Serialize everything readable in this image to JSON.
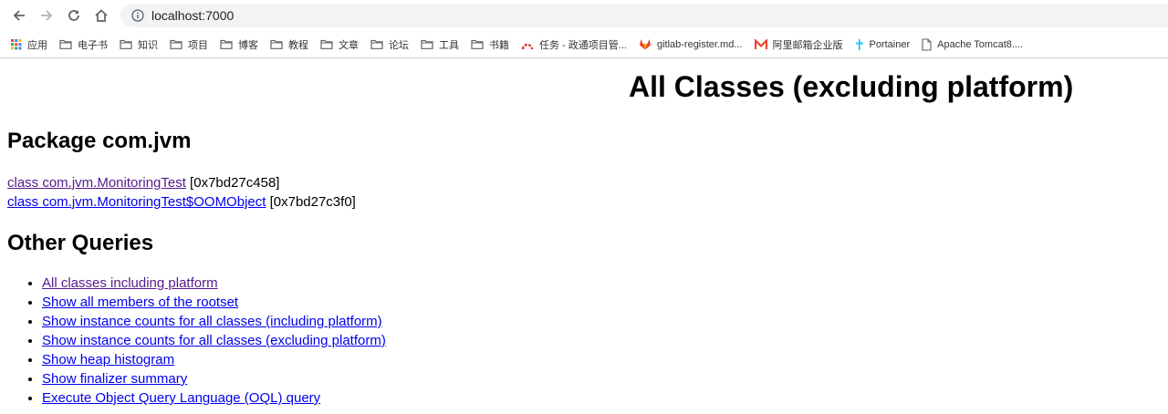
{
  "browser": {
    "url": "localhost:7000",
    "bookmarks": [
      {
        "label": "应用",
        "icon": "apps-grid-icon"
      },
      {
        "label": "电子书",
        "icon": "folder-icon"
      },
      {
        "label": "知识",
        "icon": "folder-icon"
      },
      {
        "label": "项目",
        "icon": "folder-icon"
      },
      {
        "label": "博客",
        "icon": "folder-icon"
      },
      {
        "label": "教程",
        "icon": "folder-icon"
      },
      {
        "label": "文章",
        "icon": "folder-icon"
      },
      {
        "label": "论坛",
        "icon": "folder-icon"
      },
      {
        "label": "工具",
        "icon": "folder-icon"
      },
      {
        "label": "书籍",
        "icon": "folder-icon"
      },
      {
        "label": "任务 - 政通项目管...",
        "icon": "task-arc-icon"
      },
      {
        "label": "gitlab-register.md...",
        "icon": "gitlab-fox-icon"
      },
      {
        "label": "阿里邮箱企业版",
        "icon": "mail-m-icon"
      },
      {
        "label": "Portainer",
        "icon": "portainer-icon"
      },
      {
        "label": "Apache Tomcat8....",
        "icon": "page-icon"
      }
    ]
  },
  "page": {
    "title": "All Classes (excluding platform)",
    "package_heading": "Package com.jvm",
    "classes": [
      {
        "link": "class com.jvm.MonitoringTest",
        "address": " [0x7bd27c458]",
        "visited": true
      },
      {
        "link": "class com.jvm.MonitoringTest$OOMObject",
        "address": " [0x7bd27c3f0]",
        "visited": false
      }
    ],
    "other_queries_heading": "Other Queries",
    "queries": [
      {
        "label": "All classes including platform",
        "visited": true
      },
      {
        "label": "Show all members of the rootset",
        "visited": false
      },
      {
        "label": "Show instance counts for all classes (including platform)",
        "visited": false
      },
      {
        "label": "Show instance counts for all classes (excluding platform)",
        "visited": false
      },
      {
        "label": "Show heap histogram",
        "visited": false
      },
      {
        "label": "Show finalizer summary",
        "visited": false
      },
      {
        "label": "Execute Object Query Language (OQL) query",
        "visited": false
      }
    ]
  },
  "colors": {
    "link": "#0000ee",
    "visited_link": "#551a8b",
    "omnibox_bg": "#f1f3f4"
  }
}
